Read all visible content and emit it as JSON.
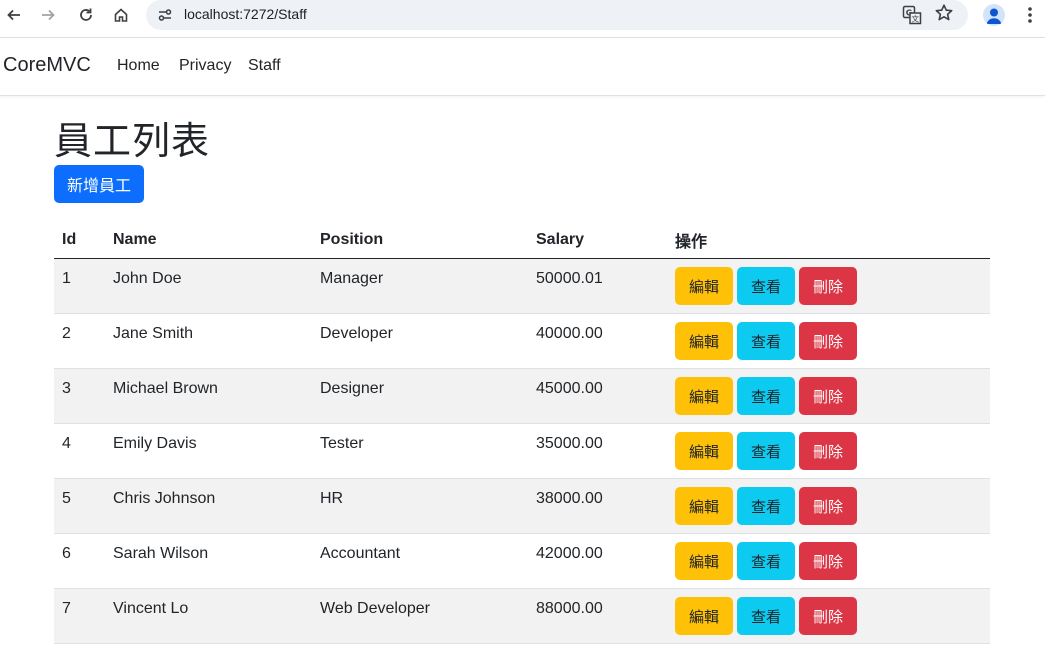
{
  "browser": {
    "url": "localhost:7272/Staff",
    "icons": {
      "back": "arrow-left",
      "forward": "arrow-right",
      "reload": "reload",
      "home": "home",
      "site_info": "tune",
      "translate": "translate",
      "bookmark": "star",
      "profile": "person",
      "menu": "more-vert"
    }
  },
  "navbar": {
    "brand": "CoreMVC",
    "links": [
      "Home",
      "Privacy",
      "Staff"
    ]
  },
  "page": {
    "title": "員工列表",
    "add_button": "新增員工"
  },
  "table": {
    "headers": {
      "id": "Id",
      "name": "Name",
      "position": "Position",
      "salary": "Salary",
      "actions": "操作"
    },
    "action_labels": {
      "edit": "編輯",
      "view": "查看",
      "delete": "刪除"
    },
    "rows": [
      {
        "id": "1",
        "name": "John Doe",
        "position": "Manager",
        "salary": "50000.01"
      },
      {
        "id": "2",
        "name": "Jane Smith",
        "position": "Developer",
        "salary": "40000.00"
      },
      {
        "id": "3",
        "name": "Michael Brown",
        "position": "Designer",
        "salary": "45000.00"
      },
      {
        "id": "4",
        "name": "Emily Davis",
        "position": "Tester",
        "salary": "35000.00"
      },
      {
        "id": "5",
        "name": "Chris Johnson",
        "position": "HR",
        "salary": "38000.00"
      },
      {
        "id": "6",
        "name": "Sarah Wilson",
        "position": "Accountant",
        "salary": "42000.00"
      },
      {
        "id": "7",
        "name": "Vincent Lo",
        "position": "Web Developer",
        "salary": "88000.00"
      }
    ]
  },
  "colors": {
    "primary": "#0d6efd",
    "warning": "#ffc107",
    "info": "#0dcaf0",
    "danger": "#dc3545",
    "stripe": "#f2f2f2"
  }
}
